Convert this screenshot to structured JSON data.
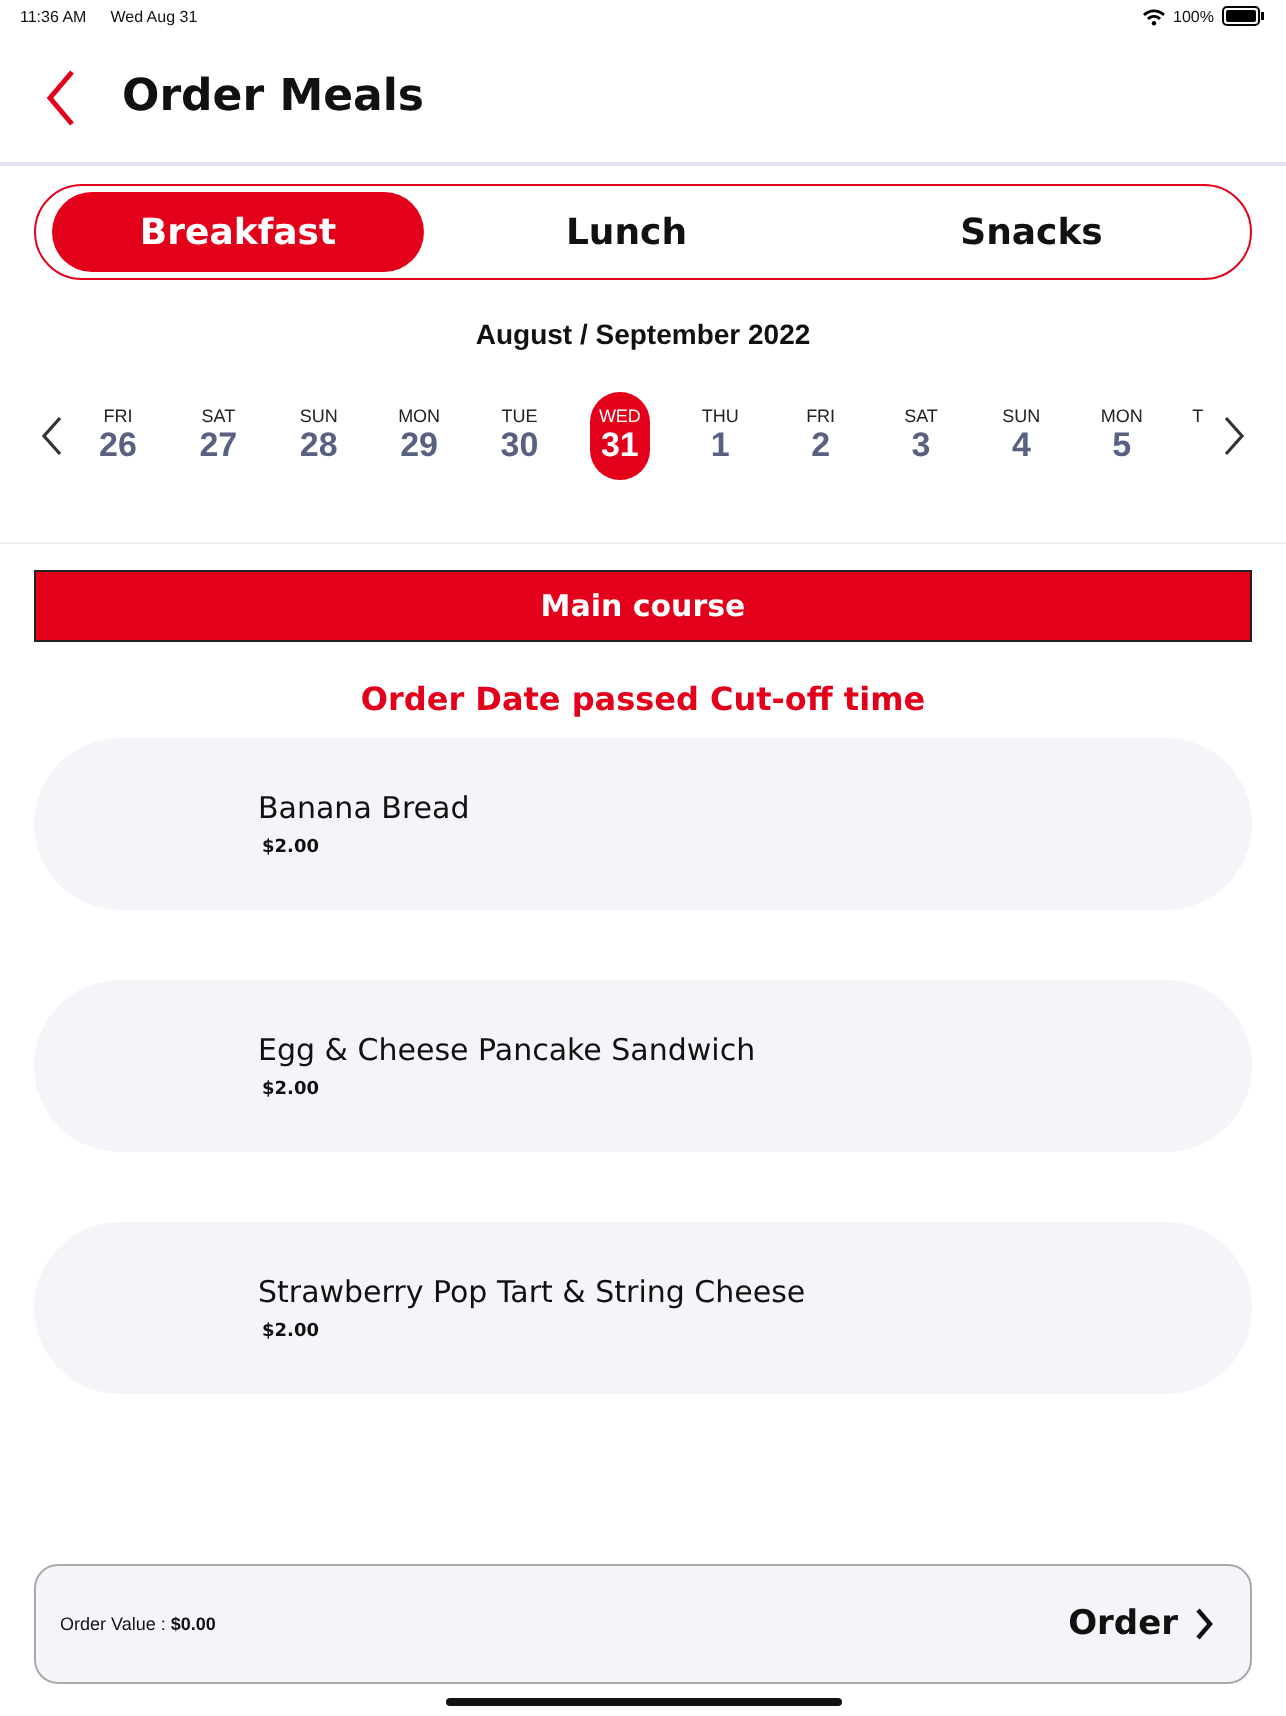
{
  "status_bar": {
    "time": "11:36 AM",
    "date": "Wed Aug 31",
    "battery": "100%"
  },
  "header": {
    "title": "Order Meals"
  },
  "tabs": [
    {
      "label": "Breakfast",
      "selected": true
    },
    {
      "label": "Lunch",
      "selected": false
    },
    {
      "label": "Snacks",
      "selected": false
    }
  ],
  "calendar": {
    "month": "August / September 2022",
    "days": [
      {
        "weekday": "FRI",
        "day": "26",
        "selected": false
      },
      {
        "weekday": "SAT",
        "day": "27",
        "selected": false
      },
      {
        "weekday": "SUN",
        "day": "28",
        "selected": false
      },
      {
        "weekday": "MON",
        "day": "29",
        "selected": false
      },
      {
        "weekday": "TUE",
        "day": "30",
        "selected": false
      },
      {
        "weekday": "WED",
        "day": "31",
        "selected": true
      },
      {
        "weekday": "THU",
        "day": "1",
        "selected": false
      },
      {
        "weekday": "FRI",
        "day": "2",
        "selected": false
      },
      {
        "weekday": "SAT",
        "day": "3",
        "selected": false
      },
      {
        "weekday": "SUN",
        "day": "4",
        "selected": false
      },
      {
        "weekday": "MON",
        "day": "5",
        "selected": false
      },
      {
        "weekday": "T",
        "selected": false
      }
    ]
  },
  "section": {
    "title": "Main course"
  },
  "warning": "Order Date passed Cut-off time",
  "items": [
    {
      "name": "Banana Bread",
      "price": "$2.00"
    },
    {
      "name": "Egg & Cheese Pancake Sandwich",
      "price": "$2.00"
    },
    {
      "name": "Strawberry Pop Tart & String Cheese",
      "price": "$2.00"
    }
  ],
  "footer": {
    "order_value": "Order Value : **$0.00**",
    "button": "Order"
  }
}
